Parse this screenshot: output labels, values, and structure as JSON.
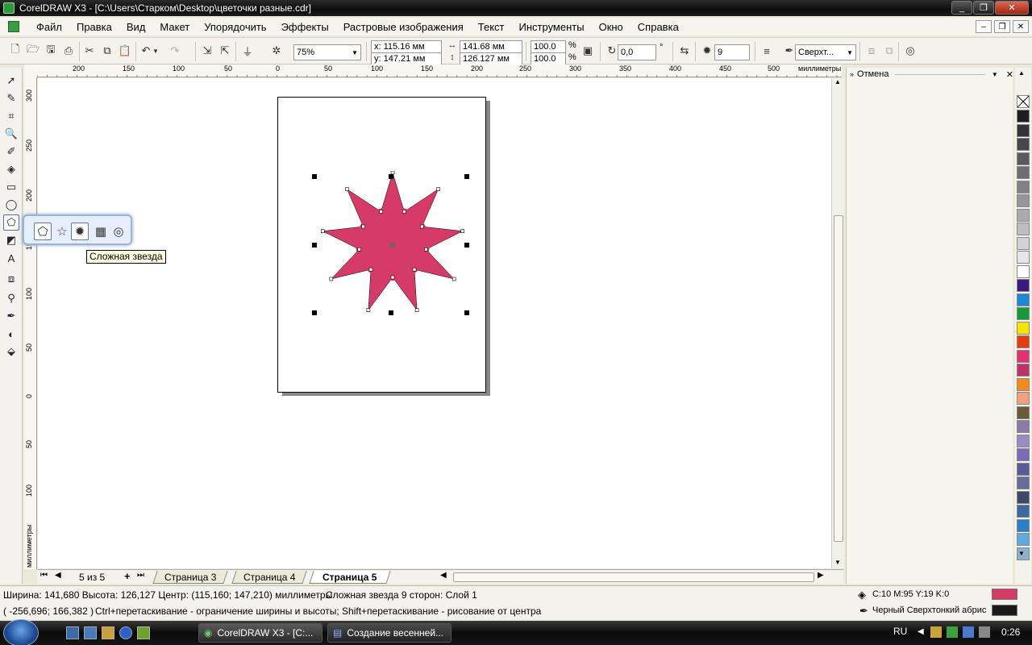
{
  "window": {
    "title": "CorelDRAW X3 - [C:\\Users\\Старком\\Desktop\\цветочки разные.cdr]"
  },
  "menu": [
    "Файл",
    "Правка",
    "Вид",
    "Макет",
    "Упорядочить",
    "Эффекты",
    "Растровые изображения",
    "Текст",
    "Инструменты",
    "Окно",
    "Справка"
  ],
  "toolbar": {
    "zoom": "75%",
    "x": "x:  115.16 мм",
    "y": "y:  147.21 мм",
    "width": "141.68 мм",
    "height": "126.127 мм",
    "scale_x": "100.0",
    "scale_y": "100.0",
    "pct": "%",
    "rotation": "0,0",
    "degree": "°",
    "points": "9",
    "outline": "Сверхт..."
  },
  "ruler": {
    "units": "миллиметры",
    "top_ticks": [
      "200",
      "150",
      "100",
      "50",
      "0",
      "50",
      "100",
      "150",
      "200",
      "250",
      "300",
      "350",
      "400",
      "450",
      "500"
    ],
    "left_ticks": [
      "300",
      "250",
      "200",
      "150",
      "100",
      "50",
      "0",
      "50",
      "100"
    ],
    "left_units": "миллиметры"
  },
  "flyout": {
    "tooltip": "Сложная звезда"
  },
  "docker": {
    "title": "Отмена"
  },
  "pages": {
    "counter": "5 из 5",
    "tabs": [
      "Страница 3",
      "Страница 4",
      "Страница 5"
    ]
  },
  "status": {
    "line1_left": "Ширина: 141,680  Высота: 126,127  Центр: (115,160; 147,210)  миллиметры",
    "line1_mid": "Сложная звезда  9 сторон: Слой 1",
    "line2_left": "( -256,696; 166,382 )",
    "line2_mid": "Ctrl+перетаскивание - ограничение ширины и высоты; Shift+перетаскивание - рисование от центра",
    "fill": "C:10 M:95 Y:19 K:0",
    "outline": "Черный  Сверхтонкий абрис"
  },
  "colors": {
    "fill": "#d63b68",
    "outline": "#1a1a1a"
  },
  "taskbar": {
    "tasks": [
      "CorelDRAW X3 - [C:...",
      "Создание весенней..."
    ],
    "lang": "RU",
    "time": "0:26"
  },
  "palette": [
    "#1e1e1e",
    "#333333",
    "#474747",
    "#5a5a5a",
    "#6e6e6e",
    "#828282",
    "#969696",
    "#aaaaaa",
    "#bebebe",
    "#d2d2d2",
    "#e6e6e6",
    "#ffffff",
    "#3a1a80",
    "#1a8ad6",
    "#159a3b",
    "#f5e400",
    "#e63a10",
    "#e8306e",
    "#c0306a",
    "#f28a1e",
    "#f0a080",
    "#6a5a3a",
    "#8a7aa8",
    "#9a8ac8",
    "#7a6ab8",
    "#5a5a98",
    "#6a6a98",
    "#404868",
    "#3a6aa0",
    "#2a80c8",
    "#60a8e0",
    "#8ab0d0"
  ]
}
